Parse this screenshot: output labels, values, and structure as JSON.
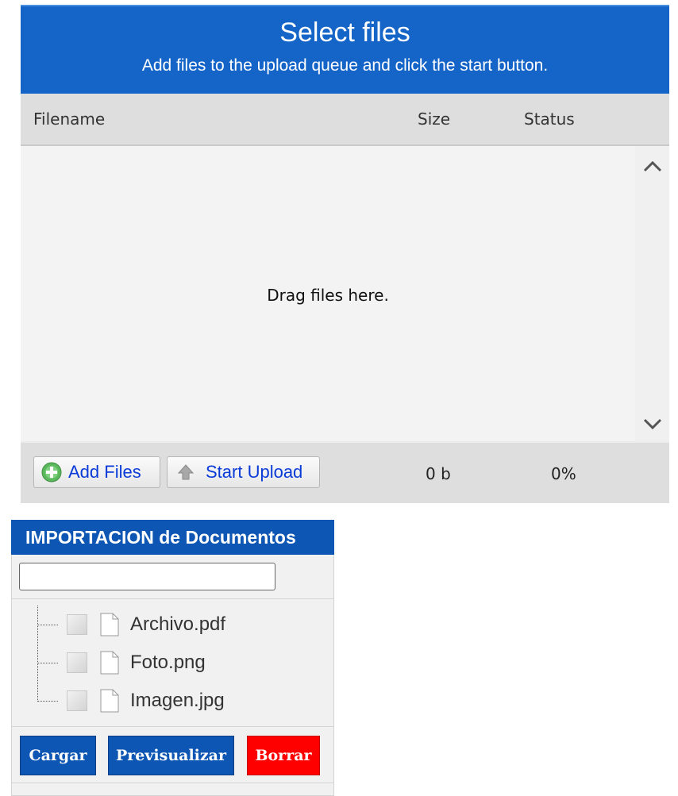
{
  "uploader": {
    "title": "Select files",
    "subtitle": "Add files to the upload queue and click the start button.",
    "columns": {
      "filename": "Filename",
      "size": "Size",
      "status": "Status"
    },
    "drop_text": "Drag files here.",
    "buttons": {
      "add_files": "Add Files",
      "start_upload": "Start Upload"
    },
    "total_size": "0 b",
    "total_status": "0%",
    "icons": {
      "add": "add-circle-icon",
      "upload": "upload-arrow-icon",
      "scroll_up": "chevron-up-icon",
      "scroll_down": "chevron-down-icon"
    },
    "colors": {
      "header": "#1565c8",
      "link_text": "#0a3bd8"
    }
  },
  "import_panel": {
    "title": "IMPORTACION de Documentos",
    "search_value": "",
    "files": [
      {
        "name": "Archivo.pdf"
      },
      {
        "name": "Foto.png"
      },
      {
        "name": "Imagen.jpg"
      }
    ],
    "buttons": {
      "cargar": "Cargar",
      "previsualizar": "Previsualizar",
      "borrar": "Borrar"
    },
    "colors": {
      "primary": "#0e56b3",
      "danger": "#ff0000"
    }
  }
}
